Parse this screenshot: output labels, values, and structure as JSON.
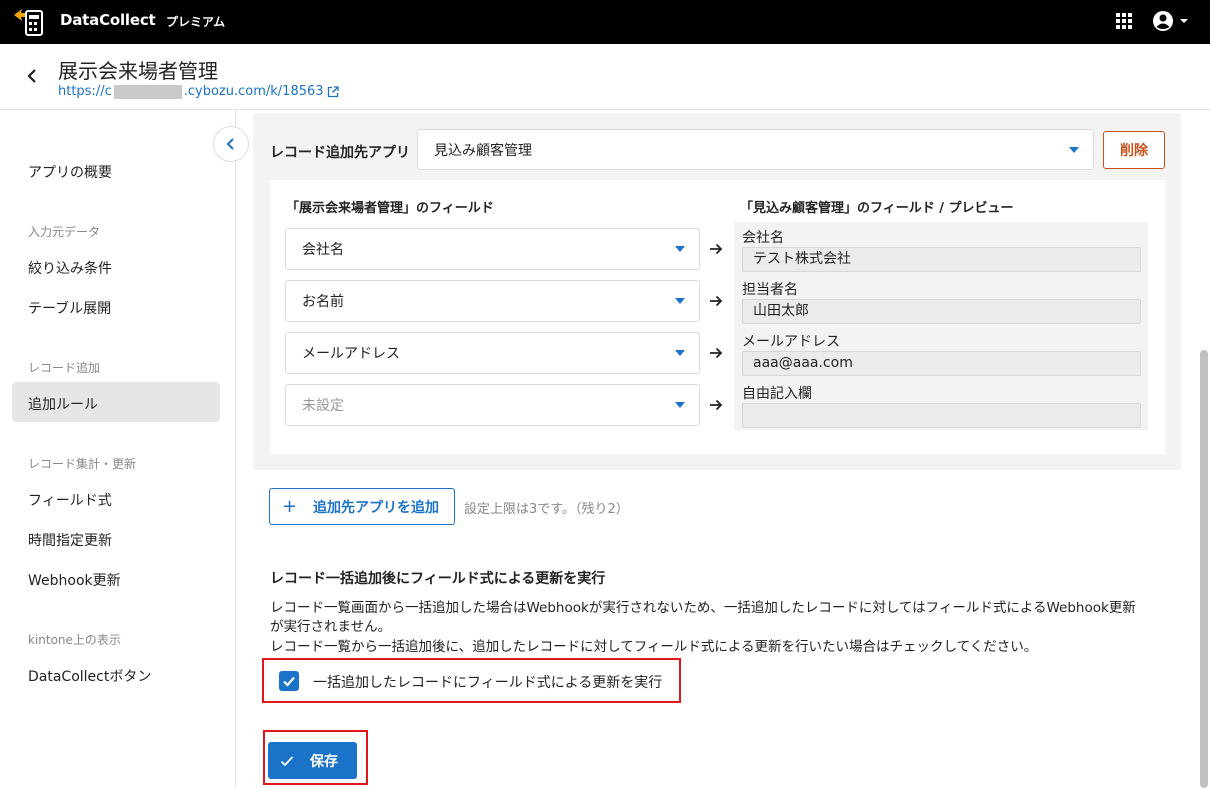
{
  "topbar": {
    "brand": "DataCollect",
    "plan": "プレミアム"
  },
  "header": {
    "title": "展示会来場者管理",
    "url_prefix": "https://c",
    "url_suffix": ".cybozu.com/k/18563"
  },
  "sidebar": {
    "overview": "アプリの概要",
    "section_input": "入力元データ",
    "filter": "絞り込み条件",
    "table_expand": "テーブル展開",
    "section_add": "レコード追加",
    "add_rule": "追加ルール",
    "section_aggregate": "レコード集計・更新",
    "field_formula": "フィールド式",
    "scheduled_update": "時間指定更新",
    "webhook_update": "Webhook更新",
    "section_kintone": "kintone上の表示",
    "dc_button": "DataCollectボタン"
  },
  "rule": {
    "target_label": "レコード追加先アプリ",
    "target_value": "見込み顧客管理",
    "delete_label": "削除",
    "source_heading": "「展示会来場者管理」のフィールド",
    "target_heading": "「見込み顧客管理」のフィールド / プレビュー",
    "mappings": [
      {
        "source": "会社名",
        "target": "会社名",
        "preview": "テスト株式会社"
      },
      {
        "source": "お名前",
        "target": "担当者名",
        "preview": "山田太郎"
      },
      {
        "source": "メールアドレス",
        "target": "メールアドレス",
        "preview": "aaa@aaa.com"
      },
      {
        "source": "未設定",
        "target": "自由記入欄",
        "preview": ""
      }
    ]
  },
  "add_app": {
    "label": "追加先アプリを追加",
    "limit": "設定上限は3です。（残り2）"
  },
  "bulk": {
    "title": "レコード一括追加後にフィールド式による更新を実行",
    "desc1": "レコード一覧画面から一括追加した場合はWebhookが実行されないため、一括追加したレコードに対してはフィールド式によるWebhook更新",
    "desc2": "が実行されません。",
    "desc3": "レコード一覧から一括追加後に、追加したレコードに対してフィールド式による更新を行いたい場合はチェックしてください。",
    "checkbox_label": "一括追加したレコードにフィールド式による更新を実行",
    "checked": true
  },
  "save_label": "保存",
  "colors": {
    "accent": "#1a73c8",
    "danger": "#c8541c",
    "highlight": "#e0161b"
  }
}
